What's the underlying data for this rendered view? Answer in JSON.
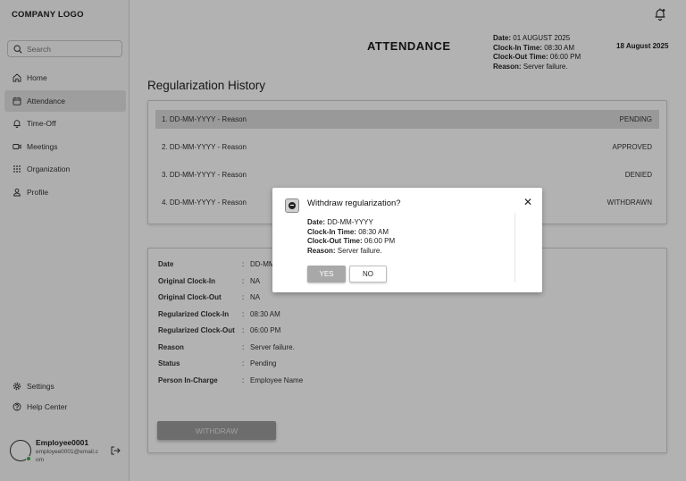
{
  "sidebar": {
    "logo": "COMPANY LOGO",
    "search_placeholder": "Search",
    "items": [
      {
        "label": "Home",
        "icon": "home-icon"
      },
      {
        "label": "Attendance",
        "icon": "calendar-icon"
      },
      {
        "label": "Time-Off",
        "icon": "bell-icon"
      },
      {
        "label": "Meetings",
        "icon": "video-icon"
      },
      {
        "label": "Organization",
        "icon": "grid-icon"
      },
      {
        "label": "Profile",
        "icon": "person-icon"
      }
    ],
    "active_item": "Attendance",
    "bottom_items": [
      {
        "label": "Settings",
        "icon": "gear-icon"
      },
      {
        "label": "Help Center",
        "icon": "help-icon"
      }
    ],
    "user": {
      "name": "Employee0001",
      "email": "employee0001@email.com",
      "status_color": "#3cb043"
    }
  },
  "header": {
    "title": "ATTENDANCE",
    "info": {
      "date_label": "Date:",
      "date": "01 AUGUST 2025",
      "clock_in_label": "Clock-In Time:",
      "clock_in": "08:30 AM",
      "clock_out_label": "Clock-Out Time:",
      "clock_out": "06:00 PM",
      "reason_label": "Reason:",
      "reason": "Server failure."
    },
    "today": "18 August 2025"
  },
  "history": {
    "title": "Regularization History",
    "rows": [
      {
        "text": "1. DD-MM-YYYY - Reason",
        "status": "PENDING"
      },
      {
        "text": "2. DD-MM-YYYY - Reason",
        "status": "APPROVED"
      },
      {
        "text": "3. DD-MM-YYYY - Reason",
        "status": "DENIED"
      },
      {
        "text": "4. DD-MM-YYYY - Reason",
        "status": "WITHDRAWN"
      }
    ]
  },
  "details": {
    "separator": ":",
    "rows": [
      {
        "label": "Date",
        "value": "DD-MM-YYYY"
      },
      {
        "label": "Original Clock-In",
        "value": "NA"
      },
      {
        "label": "Original Clock-Out",
        "value": "NA"
      },
      {
        "label": "Regularized Clock-In",
        "value": "08:30 AM"
      },
      {
        "label": "Regularized Clock-Out",
        "value": "06:00 PM"
      },
      {
        "label": "Reason",
        "value": "Server failure."
      },
      {
        "label": "Status",
        "value": "Pending"
      },
      {
        "label": "Person In-Charge",
        "value": "Employee Name"
      }
    ],
    "withdraw_label": "WITHDRAW"
  },
  "modal": {
    "title": "Withdraw regularization?",
    "close_glyph": "✕",
    "date_label": "Date:",
    "date": "DD-MM-YYYY",
    "clock_in_label": "Clock-In Time:",
    "clock_in": "08:30 AM",
    "clock_out_label": "Clock-Out Time:",
    "clock_out": "06:00 PM",
    "reason_label": "Reason:",
    "reason": "Server failure.",
    "yes_label": "YES",
    "no_label": "NO"
  }
}
